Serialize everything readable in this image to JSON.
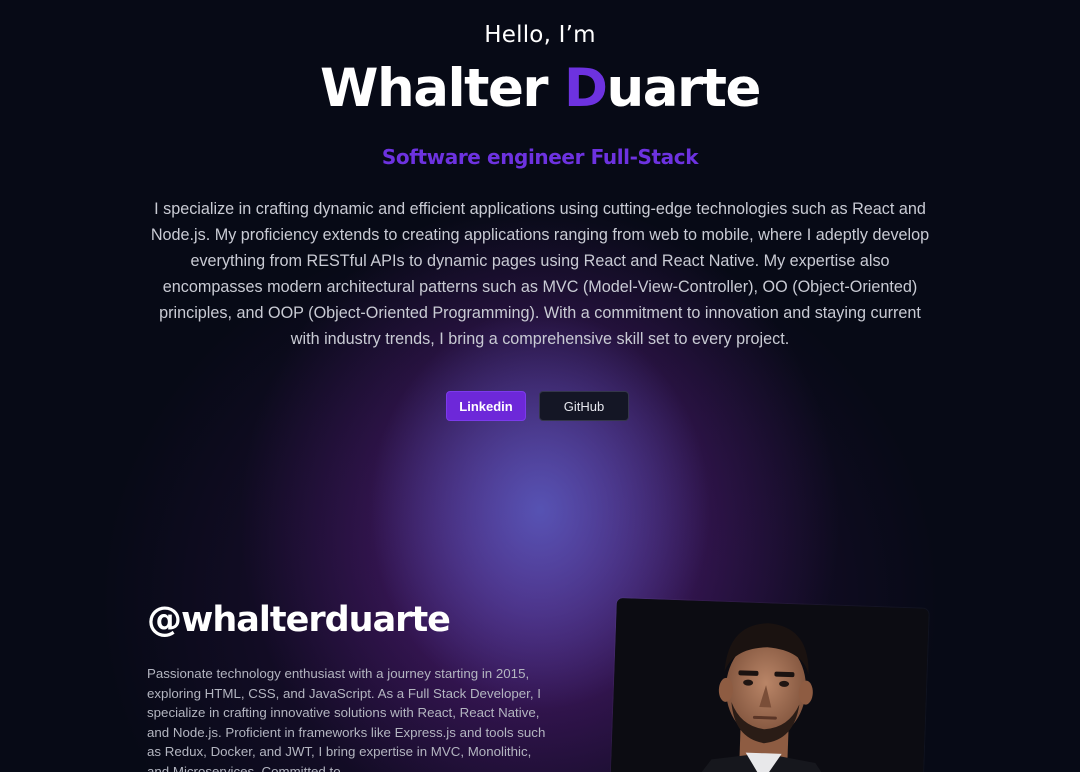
{
  "hero": {
    "greeting": "Hello, I’m",
    "name_first": "Whalter ",
    "name_accent_letter": "D",
    "name_rest": "uarte",
    "role": "Software engineer Full-Stack",
    "intro": "I specialize in crafting dynamic and efficient applications using cutting-edge technologies such as React and Node.js. My proficiency extends to creating applications ranging from web to mobile, where I adeptly develop everything from RESTful APIs to dynamic pages using React and React Native. My expertise also encompasses modern architectural patterns such as MVC (Model-View-Controller), OO (Object-Oriented) principles, and OOP (Object-Oriented Programming). With a commitment to innovation and staying current with industry trends, I bring a comprehensive skill set to every project.",
    "buttons": {
      "linkedin": "Linkedin",
      "github": "GitHub"
    }
  },
  "about": {
    "handle": "@whalterduarte",
    "bio": "Passionate technology enthusiast with a journey starting in 2015, exploring HTML, CSS, and JavaScript. As a Full Stack Developer, I specialize in crafting innovative solutions with React, React Native, and Node.js. Proficient in frameworks like Express.js and tools such as Redux, Docker, and JWT, I bring expertise in MVC, Monolithic, and Microservices. Committed to",
    "photo_icon": "profile-photo"
  },
  "colors": {
    "accent": "#6d32e0",
    "background": "#070a16",
    "button_primary": "#6d28d9",
    "button_secondary": "#141625"
  }
}
